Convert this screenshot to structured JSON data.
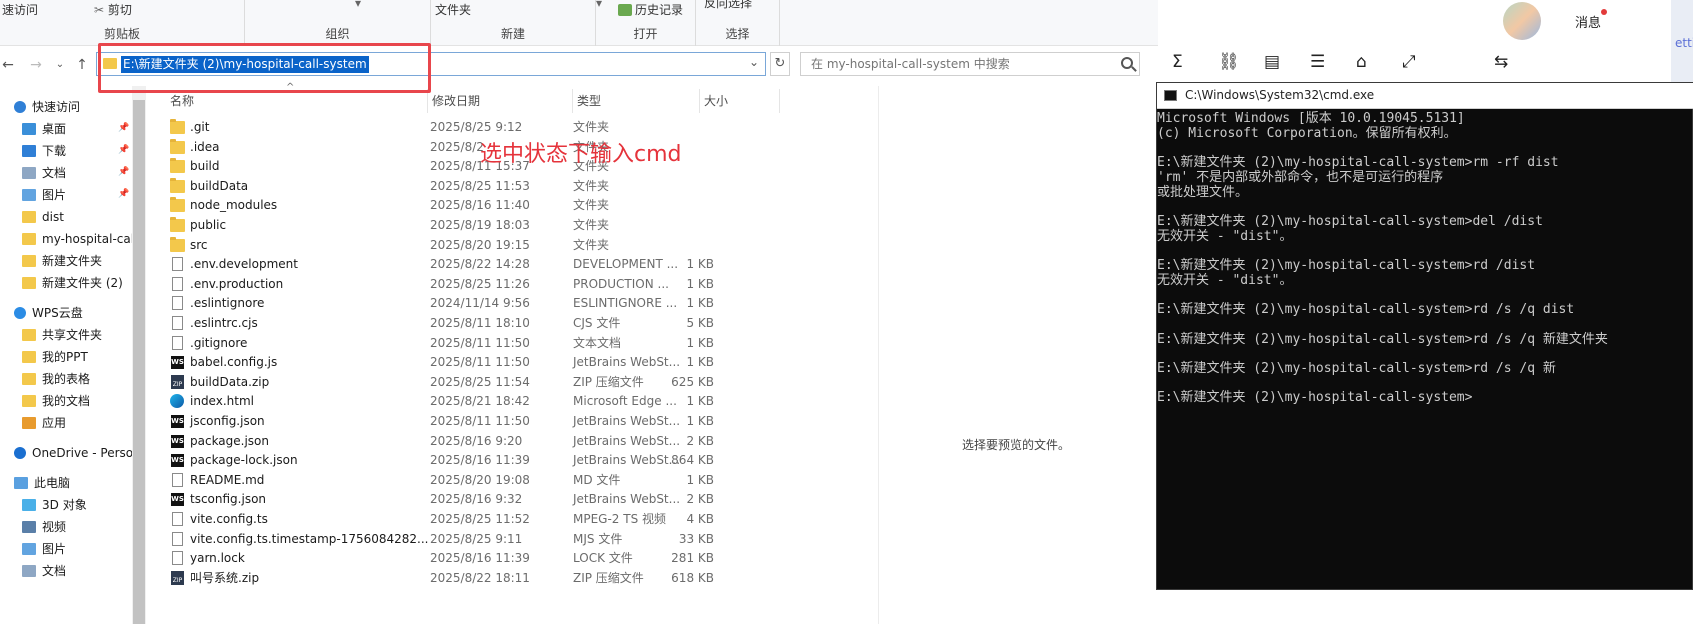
{
  "ribbon": {
    "quick_access": "速访问",
    "cut": "剪切",
    "clipboard": "剪贴板",
    "organize": "组织",
    "new_group": "新建",
    "folder_btn": "文件夹",
    "open_group": "打开",
    "history": "历史记录",
    "select_group": "选择",
    "reverse_select": "反向选择"
  },
  "address": {
    "path": "E:\\新建文件夹 (2)\\my-hospital-call-system",
    "search_placeholder": "在 my-hospital-call-system 中搜索"
  },
  "annotation": "选中状态下输入cmd",
  "sidebar": {
    "items": [
      {
        "label": "快速访问",
        "icon": "star-icon",
        "pinned": false
      },
      {
        "label": "桌面",
        "icon": "desktop-icon",
        "pinned": true
      },
      {
        "label": "下载",
        "icon": "download-icon",
        "pinned": true
      },
      {
        "label": "文档",
        "icon": "document-icon",
        "pinned": true
      },
      {
        "label": "图片",
        "icon": "picture-icon",
        "pinned": true
      },
      {
        "label": "dist",
        "icon": "folder-icon",
        "pinned": false
      },
      {
        "label": "my-hospital-cal",
        "icon": "folder-icon",
        "pinned": false
      },
      {
        "label": "新建文件夹",
        "icon": "folder-icon",
        "pinned": false
      },
      {
        "label": "新建文件夹 (2)",
        "icon": "folder-icon",
        "pinned": false
      },
      {
        "label": "WPS云盘",
        "icon": "cloud-icon",
        "pinned": false
      },
      {
        "label": "共享文件夹",
        "icon": "shared-folder-icon",
        "pinned": false
      },
      {
        "label": "我的PPT",
        "icon": "folder-icon",
        "pinned": false
      },
      {
        "label": "我的表格",
        "icon": "folder-icon",
        "pinned": false
      },
      {
        "label": "我的文档",
        "icon": "folder-icon",
        "pinned": false
      },
      {
        "label": "应用",
        "icon": "apps-icon",
        "pinned": false
      },
      {
        "label": "OneDrive - Perso",
        "icon": "onedrive-icon",
        "pinned": false
      },
      {
        "label": "此电脑",
        "icon": "computer-icon",
        "pinned": false
      },
      {
        "label": "3D 对象",
        "icon": "3d-icon",
        "pinned": false
      },
      {
        "label": "视频",
        "icon": "video-icon",
        "pinned": false
      },
      {
        "label": "图片",
        "icon": "picture-icon",
        "pinned": false
      },
      {
        "label": "文档",
        "icon": "document-icon",
        "pinned": false
      }
    ]
  },
  "columns": {
    "name": "名称",
    "date": "修改日期",
    "type": "类型",
    "size": "大小"
  },
  "files": [
    {
      "name": ".git",
      "date": "2025/8/25 9:12",
      "type": "文件夹",
      "size": "",
      "icon": "folder"
    },
    {
      "name": ".idea",
      "date": "2025/8/2",
      "type": "文件夹",
      "size": "",
      "icon": "folder"
    },
    {
      "name": "build",
      "date": "2025/8/11 15:37",
      "type": "文件夹",
      "size": "",
      "icon": "folder"
    },
    {
      "name": "buildData",
      "date": "2025/8/25 11:53",
      "type": "文件夹",
      "size": "",
      "icon": "folder"
    },
    {
      "name": "node_modules",
      "date": "2025/8/16 11:40",
      "type": "文件夹",
      "size": "",
      "icon": "folder"
    },
    {
      "name": "public",
      "date": "2025/8/19 18:03",
      "type": "文件夹",
      "size": "",
      "icon": "folder"
    },
    {
      "name": "src",
      "date": "2025/8/20 19:15",
      "type": "文件夹",
      "size": "",
      "icon": "folder"
    },
    {
      "name": ".env.development",
      "date": "2025/8/22 14:28",
      "type": "DEVELOPMENT ...",
      "size": "1 KB",
      "icon": "file"
    },
    {
      "name": ".env.production",
      "date": "2025/8/25 11:26",
      "type": "PRODUCTION ...",
      "size": "1 KB",
      "icon": "file"
    },
    {
      "name": ".eslintignore",
      "date": "2024/11/14 9:56",
      "type": "ESLINTIGNORE ...",
      "size": "1 KB",
      "icon": "file"
    },
    {
      "name": ".eslintrc.cjs",
      "date": "2025/8/11 18:10",
      "type": "CJS 文件",
      "size": "5 KB",
      "icon": "file"
    },
    {
      "name": ".gitignore",
      "date": "2025/8/11 11:50",
      "type": "文本文档",
      "size": "1 KB",
      "icon": "file"
    },
    {
      "name": "babel.config.js",
      "date": "2025/8/11 11:50",
      "type": "JetBrains WebSt...",
      "size": "1 KB",
      "icon": "ws"
    },
    {
      "name": "buildData.zip",
      "date": "2025/8/25 11:54",
      "type": "ZIP 压缩文件",
      "size": "625 KB",
      "icon": "zip"
    },
    {
      "name": "index.html",
      "date": "2025/8/21 18:42",
      "type": "Microsoft Edge ...",
      "size": "1 KB",
      "icon": "edge"
    },
    {
      "name": "jsconfig.json",
      "date": "2025/8/11 11:50",
      "type": "JetBrains WebSt...",
      "size": "1 KB",
      "icon": "ws"
    },
    {
      "name": "package.json",
      "date": "2025/8/16 9:20",
      "type": "JetBrains WebSt...",
      "size": "2 KB",
      "icon": "ws"
    },
    {
      "name": "package-lock.json",
      "date": "2025/8/16 11:39",
      "type": "JetBrains WebSt...",
      "size": "864 KB",
      "icon": "ws"
    },
    {
      "name": "README.md",
      "date": "2025/8/20 19:08",
      "type": "MD 文件",
      "size": "1 KB",
      "icon": "file"
    },
    {
      "name": "tsconfig.json",
      "date": "2025/8/16 9:32",
      "type": "JetBrains WebSt...",
      "size": "2 KB",
      "icon": "ws"
    },
    {
      "name": "vite.config.ts",
      "date": "2025/8/25 11:52",
      "type": "MPEG-2 TS 视频",
      "size": "4 KB",
      "icon": "file"
    },
    {
      "name": "vite.config.ts.timestamp-1756084282...",
      "date": "2025/8/25 9:11",
      "type": "MJS 文件",
      "size": "33 KB",
      "icon": "file"
    },
    {
      "name": "yarn.lock",
      "date": "2025/8/16 11:39",
      "type": "LOCK 文件",
      "size": "281 KB",
      "icon": "file"
    },
    {
      "name": "叫号系统.zip",
      "date": "2025/8/22 18:11",
      "type": "ZIP 压缩文件",
      "size": "618 KB",
      "icon": "zip"
    }
  ],
  "preview_text": "选择要预览的文件。",
  "app": {
    "messages_label": "消息",
    "side_text": "etti"
  },
  "cmd": {
    "title": "C:\\Windows\\System32\\cmd.exe",
    "lines": [
      "Microsoft Windows [版本 10.0.19045.5131]",
      "(c) Microsoft Corporation。保留所有权利。",
      "",
      "E:\\新建文件夹 (2)\\my-hospital-call-system>rm -rf dist",
      "'rm' 不是内部或外部命令，也不是可运行的程序",
      "或批处理文件。",
      "",
      "E:\\新建文件夹 (2)\\my-hospital-call-system>del /dist",
      "无效开关 - \"dist\"。",
      "",
      "E:\\新建文件夹 (2)\\my-hospital-call-system>rd /dist",
      "无效开关 - \"dist\"。",
      "",
      "E:\\新建文件夹 (2)\\my-hospital-call-system>rd /s /q dist",
      "",
      "E:\\新建文件夹 (2)\\my-hospital-call-system>rd /s /q 新建文件夹",
      "",
      "E:\\新建文件夹 (2)\\my-hospital-call-system>rd /s /q 新",
      "",
      "E:\\新建文件夹 (2)\\my-hospital-call-system>"
    ]
  }
}
